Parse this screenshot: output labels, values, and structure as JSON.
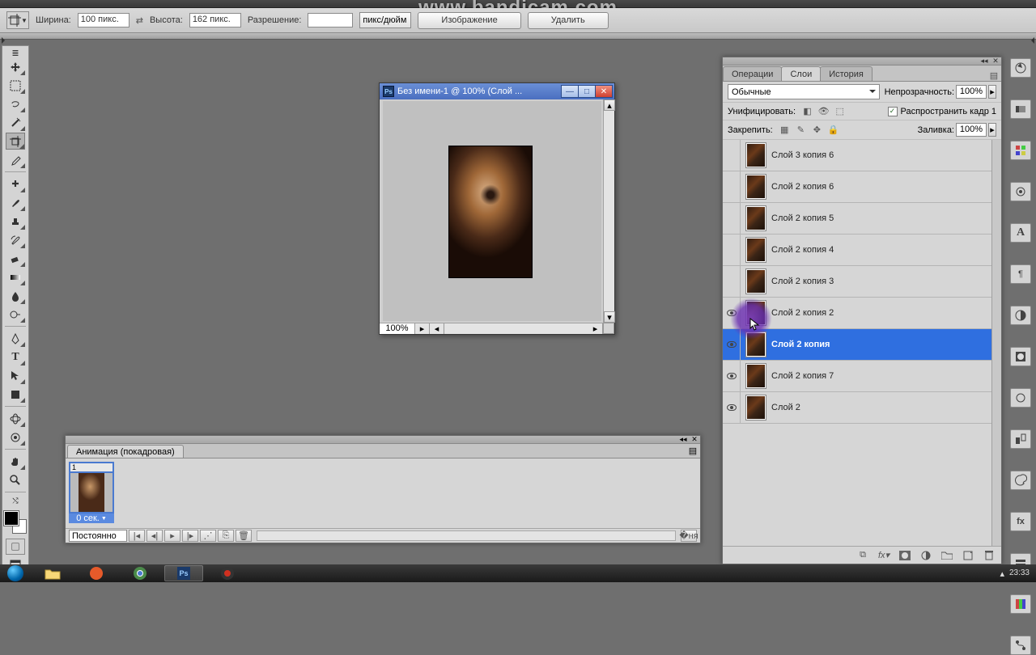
{
  "watermark": "www.bandicam.com",
  "options_bar": {
    "width_label": "Ширина:",
    "width_value": "100 пикс.",
    "height_label": "Высота:",
    "height_value": "162 пикс.",
    "resolution_label": "Разрешение:",
    "resolution_value": "",
    "units": "пикс/дюйм",
    "btn_image": "Изображение",
    "btn_delete": "Удалить"
  },
  "document": {
    "title": "Без имени-1 @ 100% (Слой ...",
    "zoom": "100%"
  },
  "layers_panel": {
    "tabs": {
      "ops": "Операции",
      "layers": "Слои",
      "history": "История"
    },
    "blend_mode": "Обычные",
    "opacity_label": "Непрозрачность:",
    "opacity_value": "100%",
    "unify_label": "Унифицировать:",
    "propagate_label": "Распространить кадр 1",
    "lock_label": "Закрепить:",
    "fill_label": "Заливка:",
    "fill_value": "100%",
    "layers": [
      {
        "name": "Слой 3 копия 6",
        "visible": false,
        "selected": false
      },
      {
        "name": "Слой 2 копия 6",
        "visible": false,
        "selected": false
      },
      {
        "name": "Слой 2 копия 5",
        "visible": false,
        "selected": false
      },
      {
        "name": "Слой 2 копия 4",
        "visible": false,
        "selected": false
      },
      {
        "name": "Слой 2 копия 3",
        "visible": false,
        "selected": false
      },
      {
        "name": "Слой 2 копия 2",
        "visible": true,
        "selected": false
      },
      {
        "name": "Слой 2 копия",
        "visible": true,
        "selected": true
      },
      {
        "name": "Слой 2 копия 7",
        "visible": true,
        "selected": false
      },
      {
        "name": "Слой 2",
        "visible": true,
        "selected": false
      }
    ]
  },
  "animation_panel": {
    "title": "Анимация (покадровая)",
    "frame_number": "1",
    "frame_delay": "0 сек.",
    "loop": "Постоянно"
  },
  "taskbar": {
    "time": "23:33"
  }
}
